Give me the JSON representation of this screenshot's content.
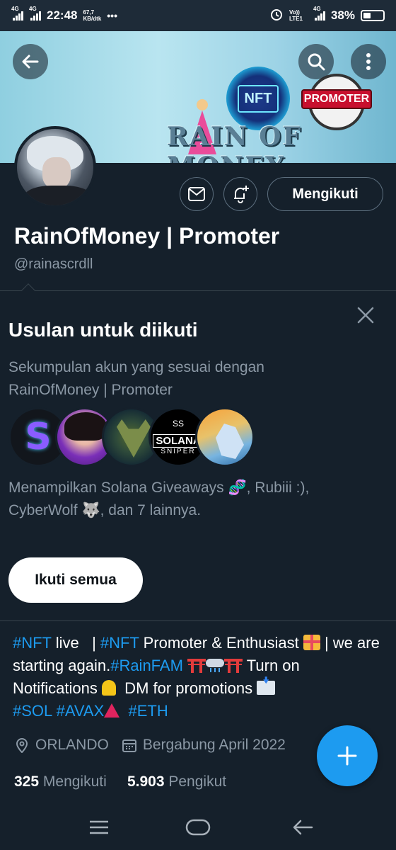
{
  "status_bar": {
    "net1": "4G",
    "net2": "4G",
    "time": "22:48",
    "speed_value": "67,7",
    "speed_unit": "KB/dtk",
    "more": "•••",
    "volte": "Vo)) LTE1",
    "net3": "4G",
    "battery": "38%"
  },
  "banner": {
    "badge_text": "NFT",
    "promoter_text": "PROMOTER",
    "title": "RAIN OF MONEY"
  },
  "profile": {
    "follow_button": "Mengikuti",
    "name": "RainOfMoney | Promoter",
    "handle": "@rainascrdll"
  },
  "suggestions": {
    "title": "Usulan untuk diikuti",
    "subtitle": "Sekumpulan akun yang sesuai dengan RainOfMoney | Promoter",
    "avatars": [
      {
        "name": "S"
      },
      {
        "name": ""
      },
      {
        "name": ""
      },
      {
        "top": "SS",
        "main": "SOLANA",
        "sub": "SNIPER"
      },
      {
        "name": ""
      }
    ],
    "description": "Menampilkan Solana Giveaways 🧬, Rubiii :), CyberWolf 🐺, dan 7 lainnya.",
    "follow_all": "Ikuti semua"
  },
  "bio": {
    "t1": "#NFT",
    "t2": " live   | ",
    "t3": "#NFT",
    "t4": " Promoter & Enthusiast ",
    "t5": " | we are starting again.",
    "t6": "#RainFAM",
    "t7": " Turn on Notifications ",
    "t8": "  DM for promotions ",
    "t9": "#SOL",
    "t10": "#AVAX",
    "t11": "#ETH"
  },
  "meta": {
    "location": "ORLANDO",
    "joined": "Bergabung April 2022"
  },
  "stats": {
    "following_count": "325",
    "following_label": "Mengikuti",
    "followers_count": "5.903",
    "followers_label": "Pengikut"
  },
  "colors": {
    "background": "#15202b",
    "accent": "#1d9bf0",
    "secondary_text": "#8b98a5"
  },
  "icons": [
    "back-arrow-icon",
    "search-icon",
    "more-vert-icon",
    "mail-icon",
    "bell-plus-icon",
    "close-icon",
    "location-icon",
    "calendar-icon",
    "plus-icon",
    "menu-icon",
    "home-icon",
    "back-icon"
  ]
}
